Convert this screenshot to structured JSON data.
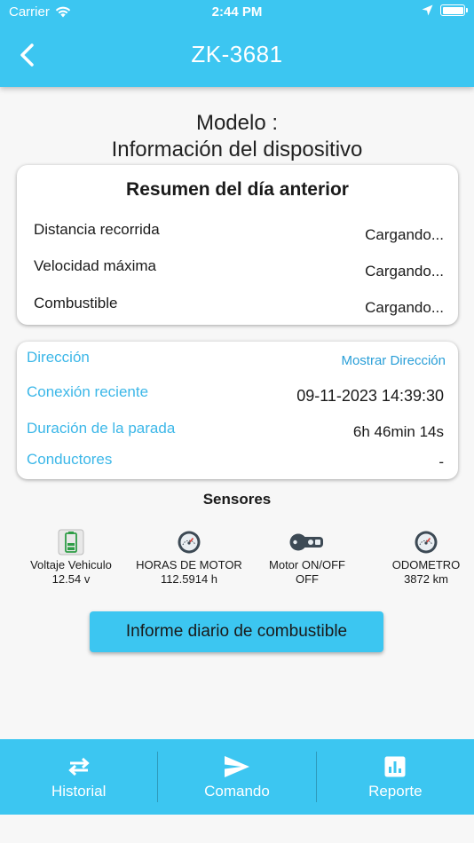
{
  "status_bar": {
    "carrier": "Carrier",
    "time": "2:44 PM"
  },
  "header": {
    "title": "ZK-3681"
  },
  "model": {
    "line1": "Modelo :",
    "line2": "Información del dispositivo"
  },
  "summary": {
    "title": "Resumen del día anterior",
    "rows": [
      {
        "label": "Distancia recorrida",
        "value": "Cargando..."
      },
      {
        "label": "Velocidad máxima",
        "value": "Cargando..."
      },
      {
        "label": "Combustible",
        "value": "Cargando..."
      }
    ]
  },
  "details": {
    "direccion_label": "Dirección",
    "direccion_link": "Mostrar Dirección",
    "conexion_label": "Conexión reciente",
    "conexion_value": "09-11-2023 14:39:30",
    "duracion_label": "Duración de la parada",
    "duracion_value": "6h 46min 14s",
    "conductores_label": "Conductores",
    "conductores_value": "-"
  },
  "sensors": {
    "title": "Sensores",
    "items": [
      {
        "name": "Voltaje Vehiculo",
        "value": "12.54 v",
        "icon": "battery-icon"
      },
      {
        "name": "HORAS DE MOTOR",
        "value": "112.5914 h",
        "icon": "gauge-icon"
      },
      {
        "name": "Motor ON/OFF",
        "value": "OFF",
        "icon": "ignition-key-icon"
      },
      {
        "name": "ODOMETRO",
        "value": "3872 km",
        "icon": "gauge-icon"
      }
    ]
  },
  "fuel_button": "Informe diario de combustible",
  "bottom_nav": [
    {
      "label": "Historial",
      "icon": "swap-arrows-icon"
    },
    {
      "label": "Comando",
      "icon": "send-icon"
    },
    {
      "label": "Reporte",
      "icon": "bar-chart-icon"
    }
  ],
  "colors": {
    "accent": "#3cc6f1",
    "label_blue": "#3cb7e8",
    "link_blue": "#2a9fd8",
    "battery_green": "#2e9d46"
  }
}
